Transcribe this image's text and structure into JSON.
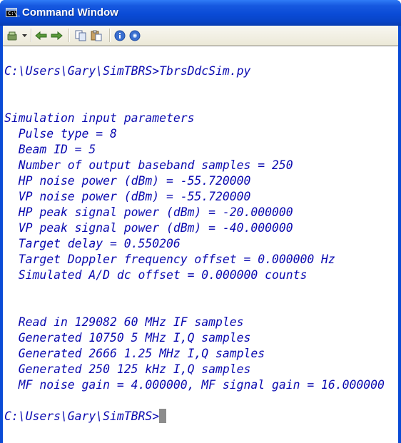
{
  "window": {
    "title": "Command Window",
    "accent": "#0a4bd6",
    "icon": "console-icon",
    "icon_text": "C:\\_"
  },
  "toolbar": {
    "buttons": [
      {
        "name": "new-icon"
      },
      {
        "name": "dropdown-arrow-icon"
      },
      {
        "name": "back-icon"
      },
      {
        "name": "forward-icon"
      },
      {
        "name": "copy-icon"
      },
      {
        "name": "paste-icon"
      },
      {
        "name": "info-icon"
      },
      {
        "name": "help-icon"
      }
    ]
  },
  "console": {
    "text_color": "#0a0ab0",
    "lines": [
      "C:\\Users\\Gary\\SimTBRS>TbrsDdcSim.py",
      "",
      "",
      "Simulation input parameters",
      "  Pulse type = 8",
      "  Beam ID = 5",
      "  Number of output baseband samples = 250",
      "  HP noise power (dBm) = -55.720000",
      "  VP noise power (dBm) = -55.720000",
      "  HP peak signal power (dBm) = -20.000000",
      "  VP peak signal power (dBm) = -40.000000",
      "  Target delay = 0.550206",
      "  Target Doppler frequency offset = 0.000000 Hz",
      "  Simulated A/D dc offset = 0.000000 counts",
      "",
      "",
      "  Read in 129082 60 MHz IF samples",
      "  Generated 10750 5 MHz I,Q samples",
      "  Generated 2666 1.25 MHz I,Q samples",
      "  Generated 250 125 kHz I,Q samples",
      "  MF noise gain = 4.000000, MF signal gain = 16.000000",
      ""
    ],
    "prompt": "C:\\Users\\Gary\\SimTBRS>"
  }
}
